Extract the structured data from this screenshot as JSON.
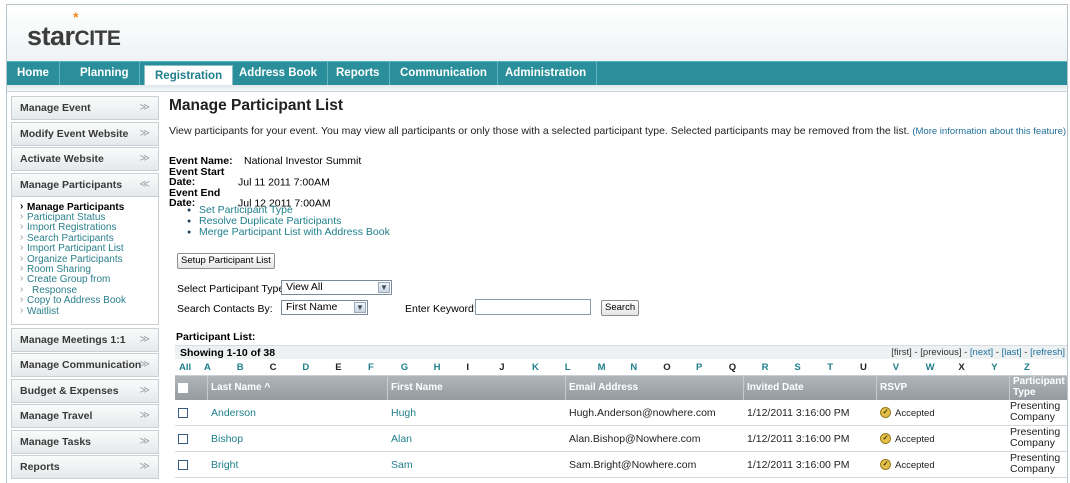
{
  "brand": {
    "logo_part1": "star",
    "logo_part2": "CITE",
    "logo_star": "*"
  },
  "nav": [
    "Home",
    "Planning",
    "Registration",
    "Address Book",
    "Reports",
    "Communication",
    "Administration"
  ],
  "nav_active": "Registration",
  "sidebar": {
    "top_items": [
      "Manage Event",
      "Modify Event Website",
      "Activate Website",
      "Manage Participants"
    ],
    "sub_items": [
      "Manage Participants",
      "Participant Status",
      "Import Registrations",
      "Search Participants",
      "Import Participant List",
      "Organize Participants",
      "Room Sharing",
      "Create Group from",
      "Response",
      "Copy to Address Book",
      "Waitlist"
    ],
    "bottom_items": [
      "Manage Meetings 1:1",
      "Manage Communication",
      "Budget & Expenses",
      "Manage Travel",
      "Manage Tasks",
      "Reports"
    ],
    "chevron_down": "≫",
    "chevron_up": "≪"
  },
  "main": {
    "title": "Manage Participant List",
    "description": "View participants for your event. You may view all participants or only those with a selected participant type. Selected participants may be removed from the list.",
    "more_info": "(More information about this feature)",
    "event": {
      "name_label": "Event Name:",
      "name_value": "National Investor Summit",
      "start_label": "Event Start Date:",
      "start_value": "Jul 11 2011 7:00AM",
      "end_label": "Event End Date:",
      "end_value": "Jul 12 2011 7:00AM"
    },
    "links": [
      "Set Participant Type",
      "Resolve Duplicate Participants",
      "Merge Participant List with Address Book"
    ],
    "setup_button": "Setup Participant List",
    "filter": {
      "type_label": "Select Participant Type:",
      "type_value": "View All",
      "search_by_label": "Search Contacts By:",
      "search_by_value": "First Name",
      "keyword_label": "Enter Keyword:",
      "keyword_value": "",
      "search_button": "Search"
    },
    "list_label": "Participant List:",
    "showing": "Showing 1-10 of 38",
    "pager": {
      "first": "[first]",
      "sep1": " - ",
      "previous": "[previous]",
      "sep2": " - ",
      "next": "[next]",
      "sep3": " - ",
      "last": "[last]",
      "sep4": " - ",
      "refresh": "[refresh]"
    },
    "alphabet": [
      "All",
      "A",
      "B",
      "C",
      "D",
      "E",
      "F",
      "G",
      "H",
      "I",
      "J",
      "K",
      "L",
      "M",
      "N",
      "O",
      "P",
      "Q",
      "R",
      "S",
      "T",
      "U",
      "V",
      "W",
      "X",
      "Y",
      "Z"
    ],
    "alphabet_linked": [
      "All",
      "A",
      "B",
      "D",
      "F",
      "G",
      "H",
      "K",
      "L",
      "M",
      "N",
      "P",
      "R",
      "S",
      "T",
      "V",
      "W",
      "Y",
      "Z"
    ],
    "columns": [
      "Last Name ^",
      "First Name",
      "Email Address",
      "Invited Date",
      "RSVP",
      "Participant Type"
    ],
    "rows": [
      {
        "last": "Anderson",
        "first": "Hugh",
        "email": "Hugh.Anderson@nowhere.com",
        "invited": "1/12/2011 3:16:00 PM",
        "rsvp": "Accepted",
        "type": "Presenting Company"
      },
      {
        "last": "Bishop",
        "first": "Alan",
        "email": "Alan.Bishop@Nowhere.com",
        "invited": "1/12/2011 3:16:00 PM",
        "rsvp": "Accepted",
        "type": "Presenting Company"
      },
      {
        "last": "Bright",
        "first": "Sam",
        "email": "Sam.Bright@Nowhere.com",
        "invited": "1/12/2011 3:16:00 PM",
        "rsvp": "Accepted",
        "type": "Presenting Company"
      }
    ]
  },
  "colors": {
    "nav_bg": "#2a8f9a",
    "link": "#1f7f8b",
    "logo_star": "#f08a1c",
    "table_header": "#a2aaae"
  }
}
